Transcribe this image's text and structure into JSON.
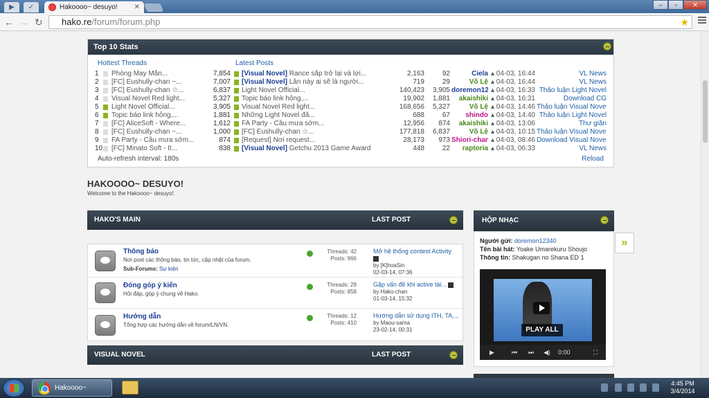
{
  "browser": {
    "tab_title": "Hakoooo~ desuyo!",
    "tab_close": "✕",
    "url_host": "hako.re",
    "url_path": "/forum/forum.php"
  },
  "stats": {
    "title": "Top 10 Stats",
    "hottest_label": "Hottest Threads",
    "latest_label": "Latest Posts",
    "rows": [
      {
        "n": "1",
        "title": "Phòng May Mắn...",
        "count": "7,854",
        "new": false,
        "tag": "[Visual Novel]",
        "latest": " Rance sắp trở lại và lợi...",
        "a": "2,163",
        "b": "92",
        "user": "Ciela",
        "uc": "#1c3f95",
        "time": "▴ 04-03, 16:44",
        "forum": "VL News"
      },
      {
        "n": "2",
        "title": "[FC] Eushully-chan ~...",
        "count": "7,007",
        "new": false,
        "tag": "[Visual Novel]",
        "latest": " Lần này ai sẽ là người...",
        "a": "719",
        "b": "29",
        "user": "Võ Lệ",
        "uc": "#4a8a1a",
        "time": "▴ 04-03, 16:44",
        "forum": "VL News"
      },
      {
        "n": "3",
        "title": "[FC] Eushully-chan ☆...",
        "count": "6,837",
        "new": false,
        "tag": "",
        "latest": "Light Novel Official...",
        "a": "140,423",
        "b": "3,905",
        "user": "doremon12340",
        "uc": "#1c3f95",
        "time": "▴ 04-03, 16:33",
        "forum": "Thảo luận Light Novel"
      },
      {
        "n": "4",
        "title": "Visual Novel Red light...",
        "count": "5,327",
        "new": false,
        "tag": "",
        "latest": "Topic báo link hỏng,...",
        "a": "19,902",
        "b": "1,881",
        "user": "akaishiki",
        "uc": "#4a8a1a",
        "time": "▴ 04-03, 16:31",
        "forum": "Download CG"
      },
      {
        "n": "5",
        "title": "Light Novel Official...",
        "count": "3,905",
        "new": true,
        "tag": "",
        "latest": "Visual Novel Red light...",
        "a": "168,656",
        "b": "5,327",
        "user": "Võ Lệ",
        "uc": "#4a8a1a",
        "time": "▴ 04-03, 14:46",
        "forum": "Thảo luận Visual Novel"
      },
      {
        "n": "6",
        "title": "Topic báo link hỏng,...",
        "count": "1,881",
        "new": true,
        "tag": "",
        "latest": "Những Light Novel đã...",
        "a": "688",
        "b": "67",
        "user": "shindo",
        "uc": "#c0168c",
        "time": "▴ 04-03, 14:40",
        "forum": "Thảo luận Light Novel"
      },
      {
        "n": "7",
        "title": "[FC] AliceSoft - Where...",
        "count": "1,612",
        "new": false,
        "tag": "",
        "latest": "FA Party - Cầu mưa sớm...",
        "a": "12,956",
        "b": "874",
        "user": "akaishiki",
        "uc": "#4a8a1a",
        "time": "▴ 04-03, 13:06",
        "forum": "Thư giãn"
      },
      {
        "n": "8",
        "title": "[FC] Eushully-chan ~...",
        "count": "1,000",
        "new": false,
        "tag": "",
        "latest": "[FC] Eushully-chan ☆...",
        "a": "177,818",
        "b": "6,837",
        "user": "Võ Lệ",
        "uc": "#4a8a1a",
        "time": "▴ 04-03, 10:15",
        "forum": "Thảo luận Visual Novel"
      },
      {
        "n": "9",
        "title": "FA Party - Cầu mưa sớm...",
        "count": "874",
        "new": false,
        "tag": "",
        "latest": "[Request] Nơi request...",
        "a": "28,173",
        "b": "973",
        "user": "Shiori-chan",
        "uc": "#c0168c",
        "time": "▴ 04-03, 08:46",
        "forum": "Download Visual Novel"
      },
      {
        "n": "10",
        "title": "[FC] Minato Soft - It...",
        "count": "838",
        "new": false,
        "tag": "[Visual Novel]",
        "latest": " Getchu 2013 Game Award",
        "a": "448",
        "b": "22",
        "user": "raptoria",
        "uc": "#4a8a1a",
        "time": "▴ 04-03, 06:33",
        "forum": "VL News"
      }
    ],
    "refresh": "Auto-refresh interval: 180s",
    "reload": "Reload"
  },
  "site": {
    "title": "HAKOOOO~ DESUYO!",
    "welcome": "Welcome to the Hakoooo~ desuyo!."
  },
  "main_cat": {
    "title": "HAKO'S MAIN",
    "last_post": "LAST POST",
    "forums": [
      {
        "name": "Thông báo",
        "desc": "Nơi post các thông báo, tin tức, cập nhật của forum.",
        "subforums_label": "Sub-Forums:",
        "subforum": " Sự kiện",
        "threads": "Threads: 42",
        "posts": "Posts: 966",
        "last_title": "Mở hệ thống contest Activity",
        "by": "by [K]hoaSin",
        "date": "02-03-14, 07:36"
      },
      {
        "name": "Đóng góp ý kiến",
        "desc": "Hỏi đáp, góp ý chung về Hako.",
        "threads": "Threads: 29",
        "posts": "Posts: 858",
        "last_title": "Gặp vấn đề khi active tài...",
        "by": "by Hako-chan",
        "date": "01-03-14, 15:32"
      },
      {
        "name": "Hướng dẫn",
        "desc": "Tổng hợp các hướng dẫn về forum/LN/VN.",
        "threads": "Threads: 12",
        "posts": "Posts: 410",
        "last_title": "Hướng dẫn sử dụng ITH, TA,...",
        "by": "by Maou-sama",
        "date": "23-02-14, 00:31"
      }
    ]
  },
  "vn_cat": {
    "title": "VISUAL NOVEL",
    "last_post": "LAST POST"
  },
  "music": {
    "title": "HỘP NHẠC",
    "sender_label": "Người gửi:",
    "sender": " doremon12340",
    "song_label": "Tên bài hát:",
    "song": " Yoake Umarekuru Shoujo",
    "info_label": "Thông tin:",
    "info": " Shakugan no Shana ED 1",
    "play_all": "PLAY ALL",
    "time": "0:00"
  },
  "taskbar": {
    "task_label": "Hakoooo~ desuy...",
    "time": "4:45 PM",
    "date": "3/4/2014"
  }
}
